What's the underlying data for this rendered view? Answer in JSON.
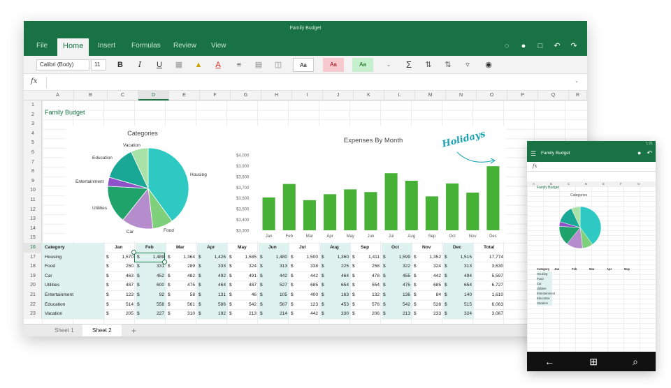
{
  "window": {
    "title": "Family Budget"
  },
  "tabs": [
    "File",
    "Home",
    "Insert",
    "Formulas",
    "Review",
    "View"
  ],
  "active_tab": "Home",
  "ribbon": {
    "font_name": "Calibri (Body)",
    "font_size": "11",
    "bold": "B",
    "italic": "I",
    "underline": "U",
    "style_normal": "Aa",
    "style_bad": "Aa",
    "style_good": "Aa",
    "sum": "Σ"
  },
  "formula_bar": {
    "fx": "fx",
    "value": ""
  },
  "columns": [
    "A",
    "B",
    "C",
    "D",
    "E",
    "F",
    "G",
    "H",
    "I",
    "J",
    "K",
    "L",
    "M",
    "N",
    "O",
    "P",
    "Q",
    "R"
  ],
  "selected_column": "D",
  "rows": [
    "1",
    "2",
    "3",
    "4",
    "5",
    "6",
    "7",
    "8",
    "9",
    "10",
    "11",
    "12",
    "13",
    "14",
    "15",
    "16",
    "17",
    "18",
    "19",
    "20",
    "21",
    "22",
    "23"
  ],
  "selected_row": "16",
  "sheet_title": "Family Budget",
  "table": {
    "headers": [
      "Category",
      "Jan",
      "Feb",
      "Mar",
      "Apr",
      "May",
      "Jun",
      "Jul",
      "Aug",
      "Sep",
      "Oct",
      "Nov",
      "Dec",
      "Total"
    ],
    "rows": [
      {
        "category": "Housing",
        "values": [
          "1,570",
          "1,489",
          "1,364",
          "1,426",
          "1,585",
          "1,480",
          "1,500",
          "1,360",
          "1,411",
          "1,599",
          "1,352",
          "1,515"
        ],
        "total": "17,774"
      },
      {
        "category": "Food",
        "values": [
          "250",
          "331",
          "289",
          "333",
          "324",
          "313",
          "338",
          "225",
          "258",
          "322",
          "324",
          "313"
        ],
        "total": "3,630"
      },
      {
        "category": "Car",
        "values": [
          "463",
          "452",
          "482",
          "492",
          "491",
          "442",
          "442",
          "464",
          "478",
          "455",
          "442",
          "494"
        ],
        "total": "5,597"
      },
      {
        "category": "Utilities",
        "values": [
          "487",
          "600",
          "475",
          "464",
          "487",
          "527",
          "685",
          "654",
          "554",
          "475",
          "685",
          "654"
        ],
        "total": "6,727"
      },
      {
        "category": "Entertainment",
        "values": [
          "123",
          "92",
          "58",
          "131",
          "46",
          "105",
          "400",
          "163",
          "132",
          "136",
          "84",
          "140"
        ],
        "total": "1,610"
      },
      {
        "category": "Education",
        "values": [
          "514",
          "558",
          "561",
          "586",
          "542",
          "567",
          "123",
          "453",
          "576",
          "542",
          "528",
          "515"
        ],
        "total": "6,063"
      },
      {
        "category": "Vacation",
        "values": [
          "205",
          "227",
          "310",
          "192",
          "213",
          "214",
          "442",
          "330",
          "206",
          "213",
          "233",
          "324"
        ],
        "total": "3,067"
      }
    ],
    "currency": "$"
  },
  "pie_chart": {
    "type": "pie",
    "title": "Categories",
    "labels": [
      "Housing",
      "Food",
      "Car",
      "Utilities",
      "Entertainment",
      "Education",
      "Vacation"
    ],
    "values": [
      17774,
      3630,
      5597,
      6727,
      1610,
      6063,
      3067
    ],
    "colors": [
      "#2ec9c3",
      "#7ed07a",
      "#b58ccc",
      "#20a36a",
      "#8f52c9",
      "#1aa896",
      "#a9e2a6"
    ]
  },
  "chart_data": {
    "type": "bar",
    "title": "Expenses By Month",
    "categories": [
      "Jan",
      "Feb",
      "Mar",
      "Apr",
      "May",
      "Jun",
      "Jul",
      "Aug",
      "Sep",
      "Oct",
      "Nov",
      "Dec"
    ],
    "values": [
      3605,
      3730,
      3580,
      3635,
      3680,
      3655,
      3830,
      3760,
      3615,
      3735,
      3650,
      3895
    ],
    "ylim": [
      3300,
      4000
    ],
    "yticks": [
      "$3,300",
      "$3,400",
      "$3,500",
      "$3,600",
      "$3,700",
      "$3,800",
      "$3,900",
      "$4,000"
    ],
    "color": "#46b134",
    "annotation": "Holidays"
  },
  "sheets": [
    "Sheet 1",
    "Sheet 2"
  ],
  "active_sheet": "Sheet 2",
  "phone": {
    "title": "Family Budget",
    "status": "1:21",
    "fx": "fx",
    "columns": [
      "A",
      "B",
      "C",
      "D",
      "E",
      "F",
      "G"
    ],
    "sheet_title": "Family Budget",
    "chart_title": "Categories",
    "headers": [
      "Category",
      "Jan",
      "Feb",
      "Mar",
      "Apr",
      "May"
    ],
    "rows": [
      "Housing",
      "Food",
      "Car",
      "Utilities",
      "Entertainment",
      "Education",
      "Vacation"
    ],
    "nav": [
      "←",
      "⊞",
      "⌕"
    ]
  }
}
